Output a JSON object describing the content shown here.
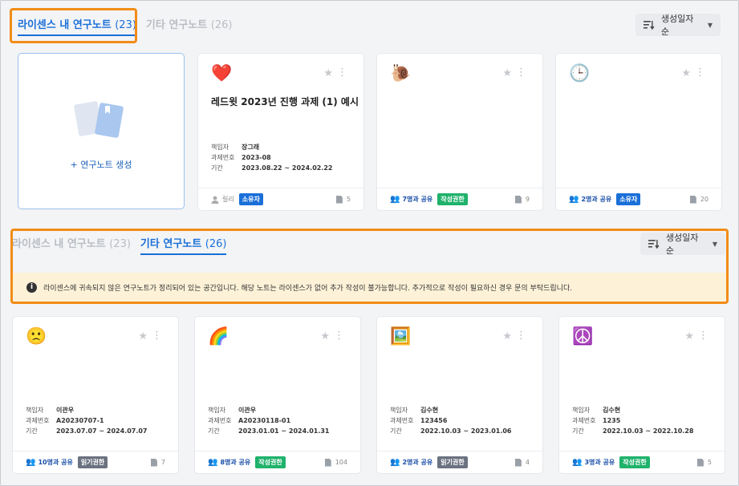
{
  "license_section": {
    "tab_license": {
      "label": "라이센스 내 연구노트",
      "count": "(23)"
    },
    "tab_other": {
      "label": "기타 연구노트",
      "count": "(26)"
    },
    "sort_label": "생성일자순",
    "create_label": "+ 연구노트 생성",
    "cards": [
      {
        "emoji": "❤️",
        "title": "레드윗 2023년 진행 과제 (1) 예시",
        "meta": [
          {
            "k": "책임자",
            "v": "장그래"
          },
          {
            "k": "과제번호",
            "v": "2023-08"
          },
          {
            "k": "기간",
            "v": "2023.08.22 ~ 2024.02.22"
          }
        ],
        "owner": "릴리",
        "badge": "소유자",
        "docs": "5"
      },
      {
        "emoji": "🐌",
        "title": "",
        "share": "7명과 공유",
        "badge": "작성권한",
        "docs": "9"
      },
      {
        "emoji": "🕒",
        "title": "",
        "share": "2명과 공유",
        "badge": "소유자",
        "docs": "20"
      }
    ]
  },
  "other_section": {
    "tab_license": {
      "label": "라이센스 내 연구노트",
      "count": "(23)"
    },
    "tab_other": {
      "label": "기타 연구노트",
      "count": "(26)"
    },
    "sort_label": "생성일자순",
    "notice": "라이센스에 귀속되지 않은 연구노트가 정리되어 있는 공간입니다. 해당 노트는 라이센스가 없어 추가 작성이 불가능합니다. 추가적으로 작성이 필요하신 경우 문의 부탁드립니다.",
    "cards": [
      {
        "emoji": "🙁",
        "meta": [
          {
            "k": "책임자",
            "v": "이관우"
          },
          {
            "k": "과제번호",
            "v": "A20230707-1"
          },
          {
            "k": "기간",
            "v": "2023.07.07 ~ 2024.07.07"
          }
        ],
        "share": "10명과 공유",
        "badge": "읽기권한",
        "docs": "7"
      },
      {
        "emoji": "🌈",
        "meta": [
          {
            "k": "책임자",
            "v": "이관우"
          },
          {
            "k": "과제번호",
            "v": "A20230118-01"
          },
          {
            "k": "기간",
            "v": "2023.01.01 ~ 2024.01.31"
          }
        ],
        "share": "8명과 공유",
        "badge": "작성권한",
        "docs": "104"
      },
      {
        "emoji": "🖼️",
        "meta": [
          {
            "k": "책임자",
            "v": "김수현"
          },
          {
            "k": "과제번호",
            "v": "123456"
          },
          {
            "k": "기간",
            "v": "2022.10.03 ~ 2023.01.06"
          }
        ],
        "share": "2명과 공유",
        "badge": "읽기권한",
        "docs": "4"
      },
      {
        "emoji": "☮️",
        "meta": [
          {
            "k": "책임자",
            "v": "김수현"
          },
          {
            "k": "과제번호",
            "v": "1235"
          },
          {
            "k": "기간",
            "v": "2022.10.03 ~ 2022.10.28"
          }
        ],
        "share": "3명과 공유",
        "badge": "작성권한",
        "docs": "5"
      }
    ]
  },
  "colors": {
    "accent": "#1a6fd8",
    "highlight": "#f28c18",
    "owner_badge": "#1a6fd8",
    "write_badge": "#1fb26b",
    "read_badge": "#6b7280"
  }
}
